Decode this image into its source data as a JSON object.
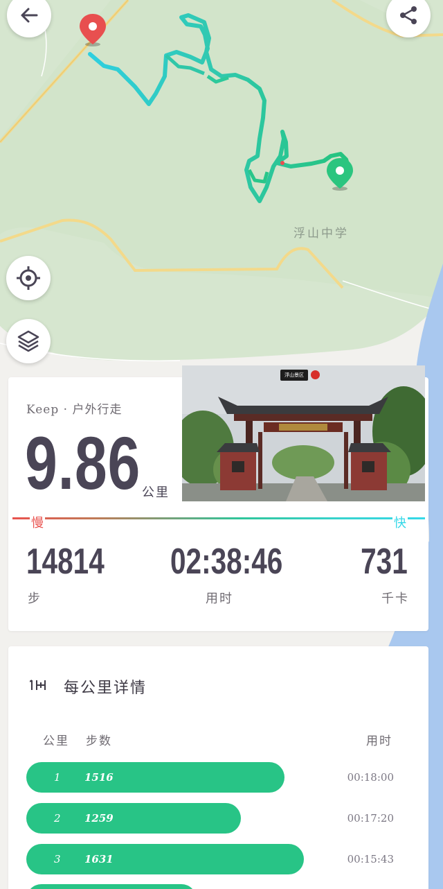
{
  "map": {
    "place_label": "浮山中学",
    "colors": {
      "forest": "#d6e6cf",
      "land": "#f2f1ee",
      "water": "#a9c8ef",
      "road": "#f3d98a",
      "track_start": "#2ecfe0",
      "track_end": "#25c37d",
      "start_pin": "#e84f4f",
      "end_pin": "#2bc57f"
    }
  },
  "buttons": {
    "back": "back-arrow-icon",
    "share": "share-icon",
    "locate": "crosshair-icon",
    "layers": "layers-icon"
  },
  "summary": {
    "brand": "Keep · 户外行走",
    "distance": "9.86",
    "distance_unit": "公里",
    "photo_sign": "浮山景区",
    "pace_slow": "慢",
    "pace_fast": "快",
    "steps": "14814",
    "steps_label": "步",
    "duration": "02:38:46",
    "duration_label": "用时",
    "calories": "731",
    "calories_label": "千卡"
  },
  "per_km": {
    "title": "每公里详情",
    "headers": {
      "km": "公里",
      "steps": "步数",
      "time": "用时"
    },
    "rows": [
      {
        "km": "1",
        "steps": "1516",
        "time": "00:18:00",
        "steps_value": 1516
      },
      {
        "km": "2",
        "steps": "1259",
        "time": "00:17:20",
        "steps_value": 1259
      },
      {
        "km": "3",
        "steps": "1631",
        "time": "00:15:43",
        "steps_value": 1631
      },
      {
        "km": "",
        "steps": "",
        "time": "",
        "steps_value": 1000
      }
    ]
  }
}
